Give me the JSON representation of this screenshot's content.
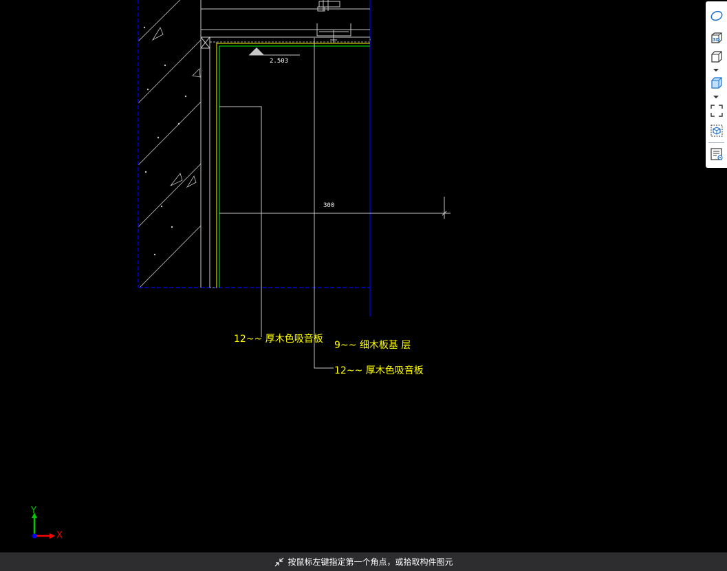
{
  "drawing": {
    "labels": {
      "panel_left": "12~~ 厚木色吸音板",
      "board_9": "9~~ 细木板基 层",
      "panel_right": "12~~ 厚木色吸音板"
    },
    "dimensions": {
      "elevation": "2.503",
      "width": "300"
    },
    "ucs": {
      "y": "Y",
      "x": "X"
    },
    "colors": {
      "background": "#000000",
      "text": "#ffff00",
      "border": "#0000ff",
      "lines": "#c8c8c8",
      "finish": "#00ff00"
    }
  },
  "toolbar": {
    "items": [
      {
        "name": "orbit-icon"
      },
      {
        "name": "3d-view-icon"
      },
      {
        "name": "cube-view-icon"
      },
      {
        "name": "cube-solid-icon"
      },
      {
        "name": "fullscreen-icon"
      },
      {
        "name": "section-box-icon"
      },
      {
        "name": "property-list-icon"
      }
    ]
  },
  "status": {
    "message": "按鼠标左键指定第一个角点，或拾取构件图元"
  }
}
